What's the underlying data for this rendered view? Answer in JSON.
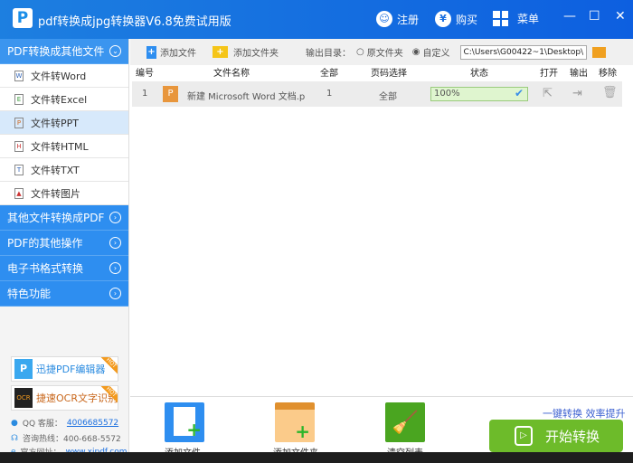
{
  "app": {
    "title": "pdf转换成jpg转换器V6.8免费试用版",
    "logo": "P"
  },
  "titlebar": {
    "register": "注册",
    "buy": "购买",
    "menu": "菜单",
    "minimize": "—",
    "maximize": "☐",
    "close": "✕"
  },
  "sidebar": {
    "section_title": "PDF转换成其他文件",
    "items": [
      {
        "label": "文件转Word",
        "icon": "W"
      },
      {
        "label": "文件转Excel",
        "icon": "E"
      },
      {
        "label": "文件转PPT",
        "icon": "P"
      },
      {
        "label": "文件转HTML",
        "icon": "H"
      },
      {
        "label": "文件转TXT",
        "icon": "T"
      },
      {
        "label": "文件转图片",
        "icon": "▲"
      }
    ],
    "categories": [
      "其他文件转换成PDF",
      "PDF的其他操作",
      "电子书格式转换",
      "特色功能"
    ],
    "promos": [
      {
        "label": "迅捷PDF编辑器",
        "badge": "HOT"
      },
      {
        "label": "捷速OCR文字识别",
        "badge": "HOT"
      }
    ],
    "contact": {
      "qq_label": "QQ 客服：",
      "qq": "4006685572",
      "hotline": "咨询热线：400-668-5572",
      "site_label": "官方网址：",
      "site": "www.xjpdf.com"
    }
  },
  "toolbar": {
    "add_file": "添加文件",
    "add_folder": "添加文件夹",
    "output_label": "输出目录：",
    "opt_original": "原文件夹",
    "opt_custom": "自定义",
    "output_path": "C:\\Users\\G00422~1\\Desktop\\"
  },
  "table": {
    "headers": [
      "编号",
      "文件名称",
      "全部",
      "页码选择",
      "状态",
      "打开",
      "输出",
      "移除"
    ],
    "rows": [
      {
        "num": "1",
        "icon": "P",
        "name": "新建 Microsoft Word 文档.pp",
        "total": "1",
        "pages": "全部",
        "progress": "100%"
      }
    ]
  },
  "bottom": {
    "add_file": "添加文件",
    "add_folder": "添加文件夹",
    "clear": "清空列表",
    "slogan": "一键转换  效率提升",
    "start": "开始转换"
  },
  "colors": {
    "accent": "#2e8ef0",
    "start": "#6dbb2a"
  }
}
